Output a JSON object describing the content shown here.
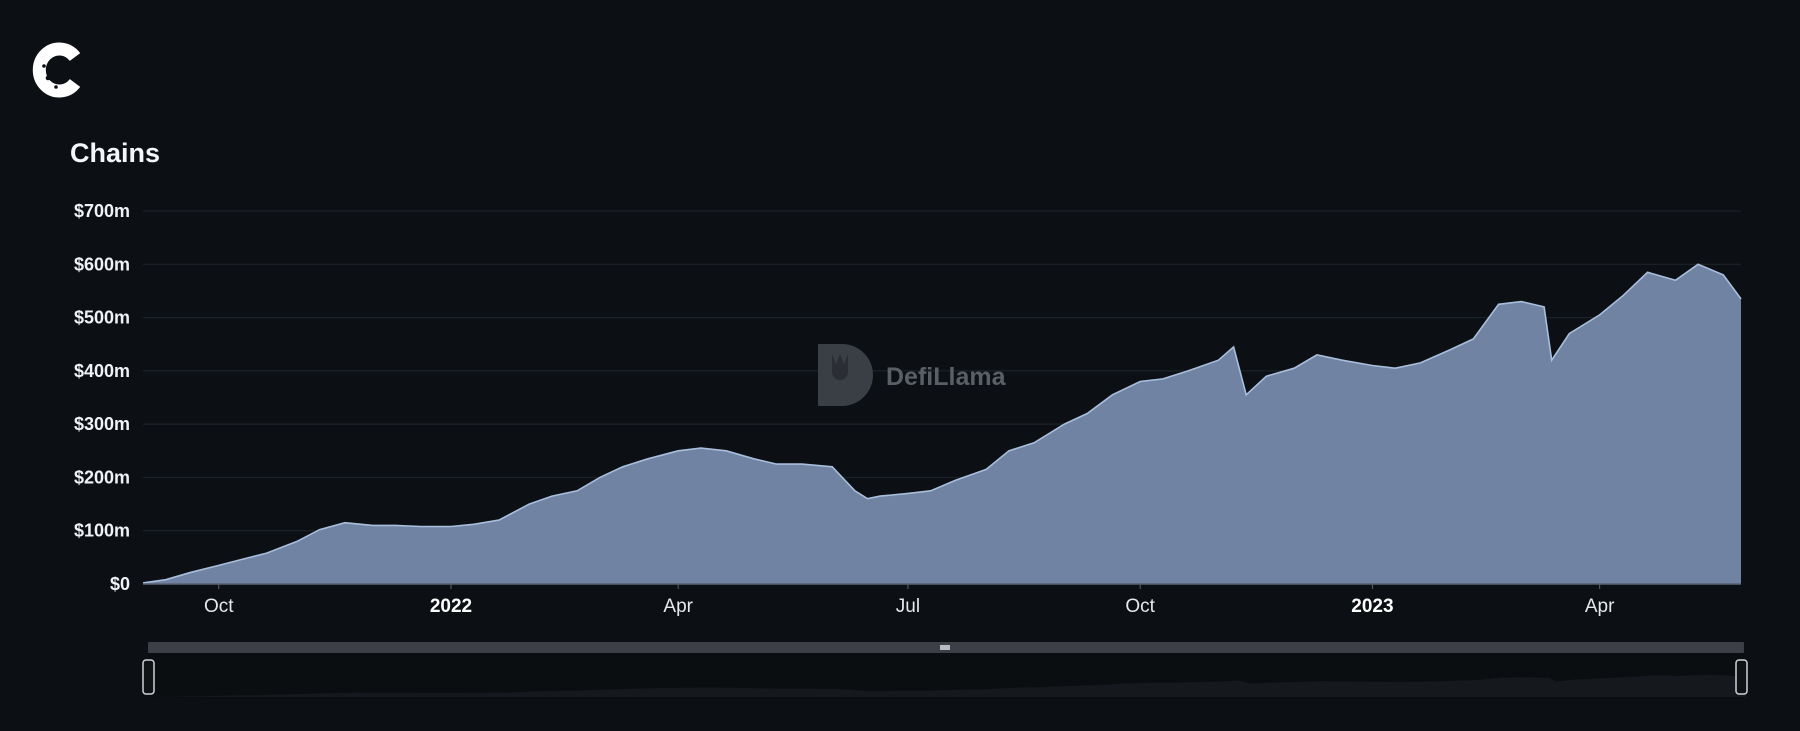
{
  "header": {
    "logo_icon": "coinmarket-c-logo"
  },
  "colors": {
    "background": "#0c1014",
    "area_fill": "#7083a3",
    "area_line": "#a9bedc",
    "grid": "#1f252c"
  },
  "watermark": {
    "text": "DefiLlama",
    "icon": "llama-icon"
  },
  "chart_data": {
    "type": "area",
    "title": "Chains",
    "y_unit": "USD",
    "ylim": [
      0,
      700000000
    ],
    "y_tick_labels": [
      "$0",
      "$100m",
      "$200m",
      "$300m",
      "$400m",
      "$500m",
      "$600m",
      "$700m"
    ],
    "x_tick_labels": [
      "Oct",
      "2022",
      "Apr",
      "Jul",
      "Oct",
      "2023",
      "Apr"
    ],
    "x_tick_dates": [
      "2021-10-01",
      "2022-01-01",
      "2022-04-01",
      "2022-07-01",
      "2022-10-01",
      "2023-01-01",
      "2023-04-01"
    ],
    "x_year_labels": [
      "2022",
      "2023"
    ],
    "xlim": [
      "2021-09-01",
      "2023-05-27"
    ],
    "grid": true,
    "legend": "none",
    "series": [
      {
        "values_in_millions": true,
        "x": [
          "2021-09-01",
          "2021-09-10",
          "2021-09-20",
          "2021-10-01",
          "2021-10-10",
          "2021-10-20",
          "2021-11-01",
          "2021-11-10",
          "2021-11-20",
          "2021-12-01",
          "2021-12-10",
          "2021-12-20",
          "2022-01-01",
          "2022-01-10",
          "2022-01-20",
          "2022-02-01",
          "2022-02-10",
          "2022-02-20",
          "2022-03-01",
          "2022-03-10",
          "2022-03-20",
          "2022-04-01",
          "2022-04-10",
          "2022-04-20",
          "2022-05-01",
          "2022-05-10",
          "2022-05-20",
          "2022-06-01",
          "2022-06-10",
          "2022-06-15",
          "2022-06-20",
          "2022-07-01",
          "2022-07-10",
          "2022-07-20",
          "2022-08-01",
          "2022-08-10",
          "2022-08-20",
          "2022-09-01",
          "2022-09-10",
          "2022-09-20",
          "2022-10-01",
          "2022-10-10",
          "2022-10-20",
          "2022-11-01",
          "2022-11-07",
          "2022-11-12",
          "2022-11-20",
          "2022-12-01",
          "2022-12-10",
          "2022-12-20",
          "2023-01-01",
          "2023-01-10",
          "2023-01-20",
          "2023-02-01",
          "2023-02-10",
          "2023-02-20",
          "2023-03-01",
          "2023-03-10",
          "2023-03-13",
          "2023-03-20",
          "2023-04-01",
          "2023-04-10",
          "2023-04-20",
          "2023-05-01",
          "2023-05-10",
          "2023-05-20",
          "2023-05-27"
        ],
        "values": [
          2,
          8,
          22,
          35,
          46,
          58,
          80,
          102,
          115,
          110,
          110,
          108,
          108,
          112,
          120,
          150,
          165,
          175,
          200,
          220,
          235,
          250,
          255,
          250,
          235,
          225,
          225,
          220,
          175,
          160,
          165,
          170,
          175,
          195,
          215,
          250,
          265,
          300,
          320,
          355,
          380,
          385,
          400,
          420,
          445,
          355,
          390,
          405,
          430,
          420,
          410,
          405,
          415,
          440,
          460,
          525,
          530,
          520,
          420,
          470,
          505,
          540,
          585,
          570,
          600,
          580,
          535
        ]
      }
    ]
  }
}
